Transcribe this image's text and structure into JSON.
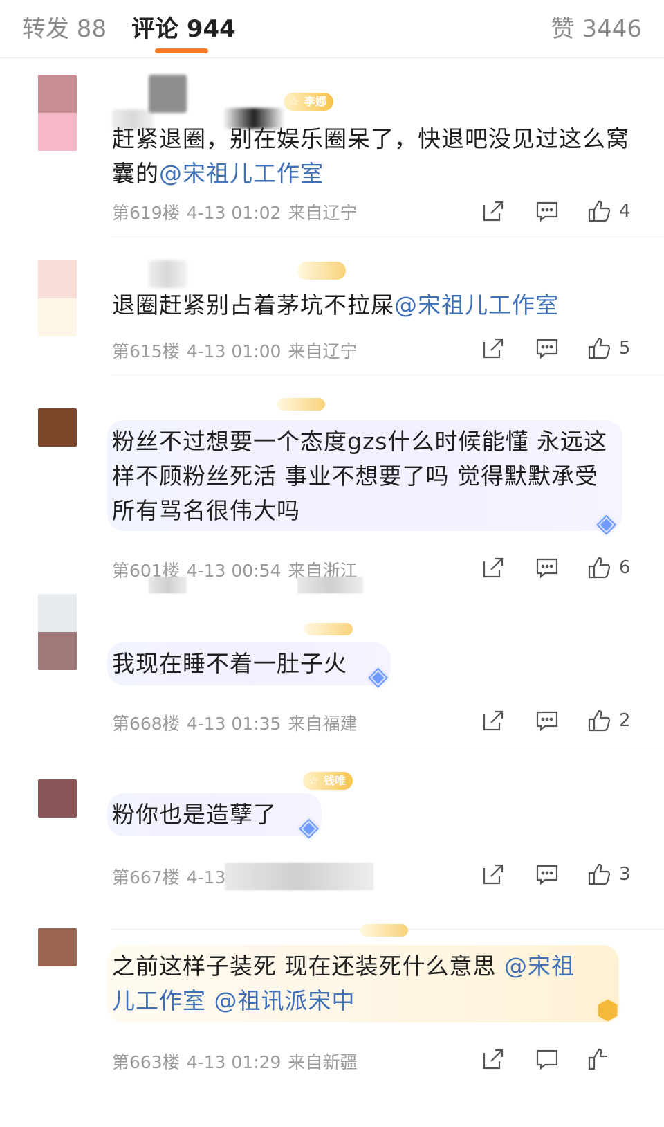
{
  "tabs": {
    "repost": "转发 88",
    "comments": "评论 944",
    "likes": "赞 3446",
    "active": "comments"
  },
  "colors": {
    "accent": "#f47c2c",
    "mention": "#3f6fb5",
    "meta": "#9a9a9a"
  },
  "icons": {
    "share": "share-icon",
    "comment": "comment-icon",
    "like": "thumbs-up-icon",
    "gem": "diamond-gem-icon"
  },
  "comments": [
    {
      "badge": "李娜",
      "text": "赶紧退圈，别在娱乐圈呆了，快退吧没见过这么窝囊的",
      "mention": "@宋祖儿工作室",
      "floor": "第619楼",
      "time": "4-13 01:02",
      "location": "来自辽宁",
      "likes": "4"
    },
    {
      "badge": "",
      "text": "退圈赶紧别占着茅坑不拉屎",
      "mention": "@宋祖儿工作室",
      "floor": "第615楼",
      "time": "4-13 01:00",
      "location": "来自辽宁",
      "likes": "5"
    },
    {
      "badge": "",
      "text": "粉丝不过想要一个态度gzs什么时候能懂 永远这样不顾粉丝死活 事业不想要了吗 觉得默默承受所有骂名很伟大吗",
      "mention": "",
      "floor": "第601楼",
      "time": "4-13 00:54",
      "location": "来自浙江",
      "likes": "6"
    },
    {
      "badge": "",
      "text": "我现在睡不着一肚子火",
      "mention": "",
      "floor": "第668楼",
      "time": "4-13 01:35",
      "location": "来自福建",
      "likes": "2"
    },
    {
      "badge": "钱唯",
      "text": "粉你也是造孽了",
      "mention": "",
      "floor": "第667楼",
      "time": "4-13",
      "location": "",
      "likes": "3"
    },
    {
      "badge": "",
      "text": "之前这样子装死 现在还装死什么意思",
      "mention": "@宋祖儿工作室 @祖讯派宋中",
      "floor": "第663楼",
      "time": "4-13 01:29",
      "location": "来自新疆",
      "likes": ""
    }
  ]
}
